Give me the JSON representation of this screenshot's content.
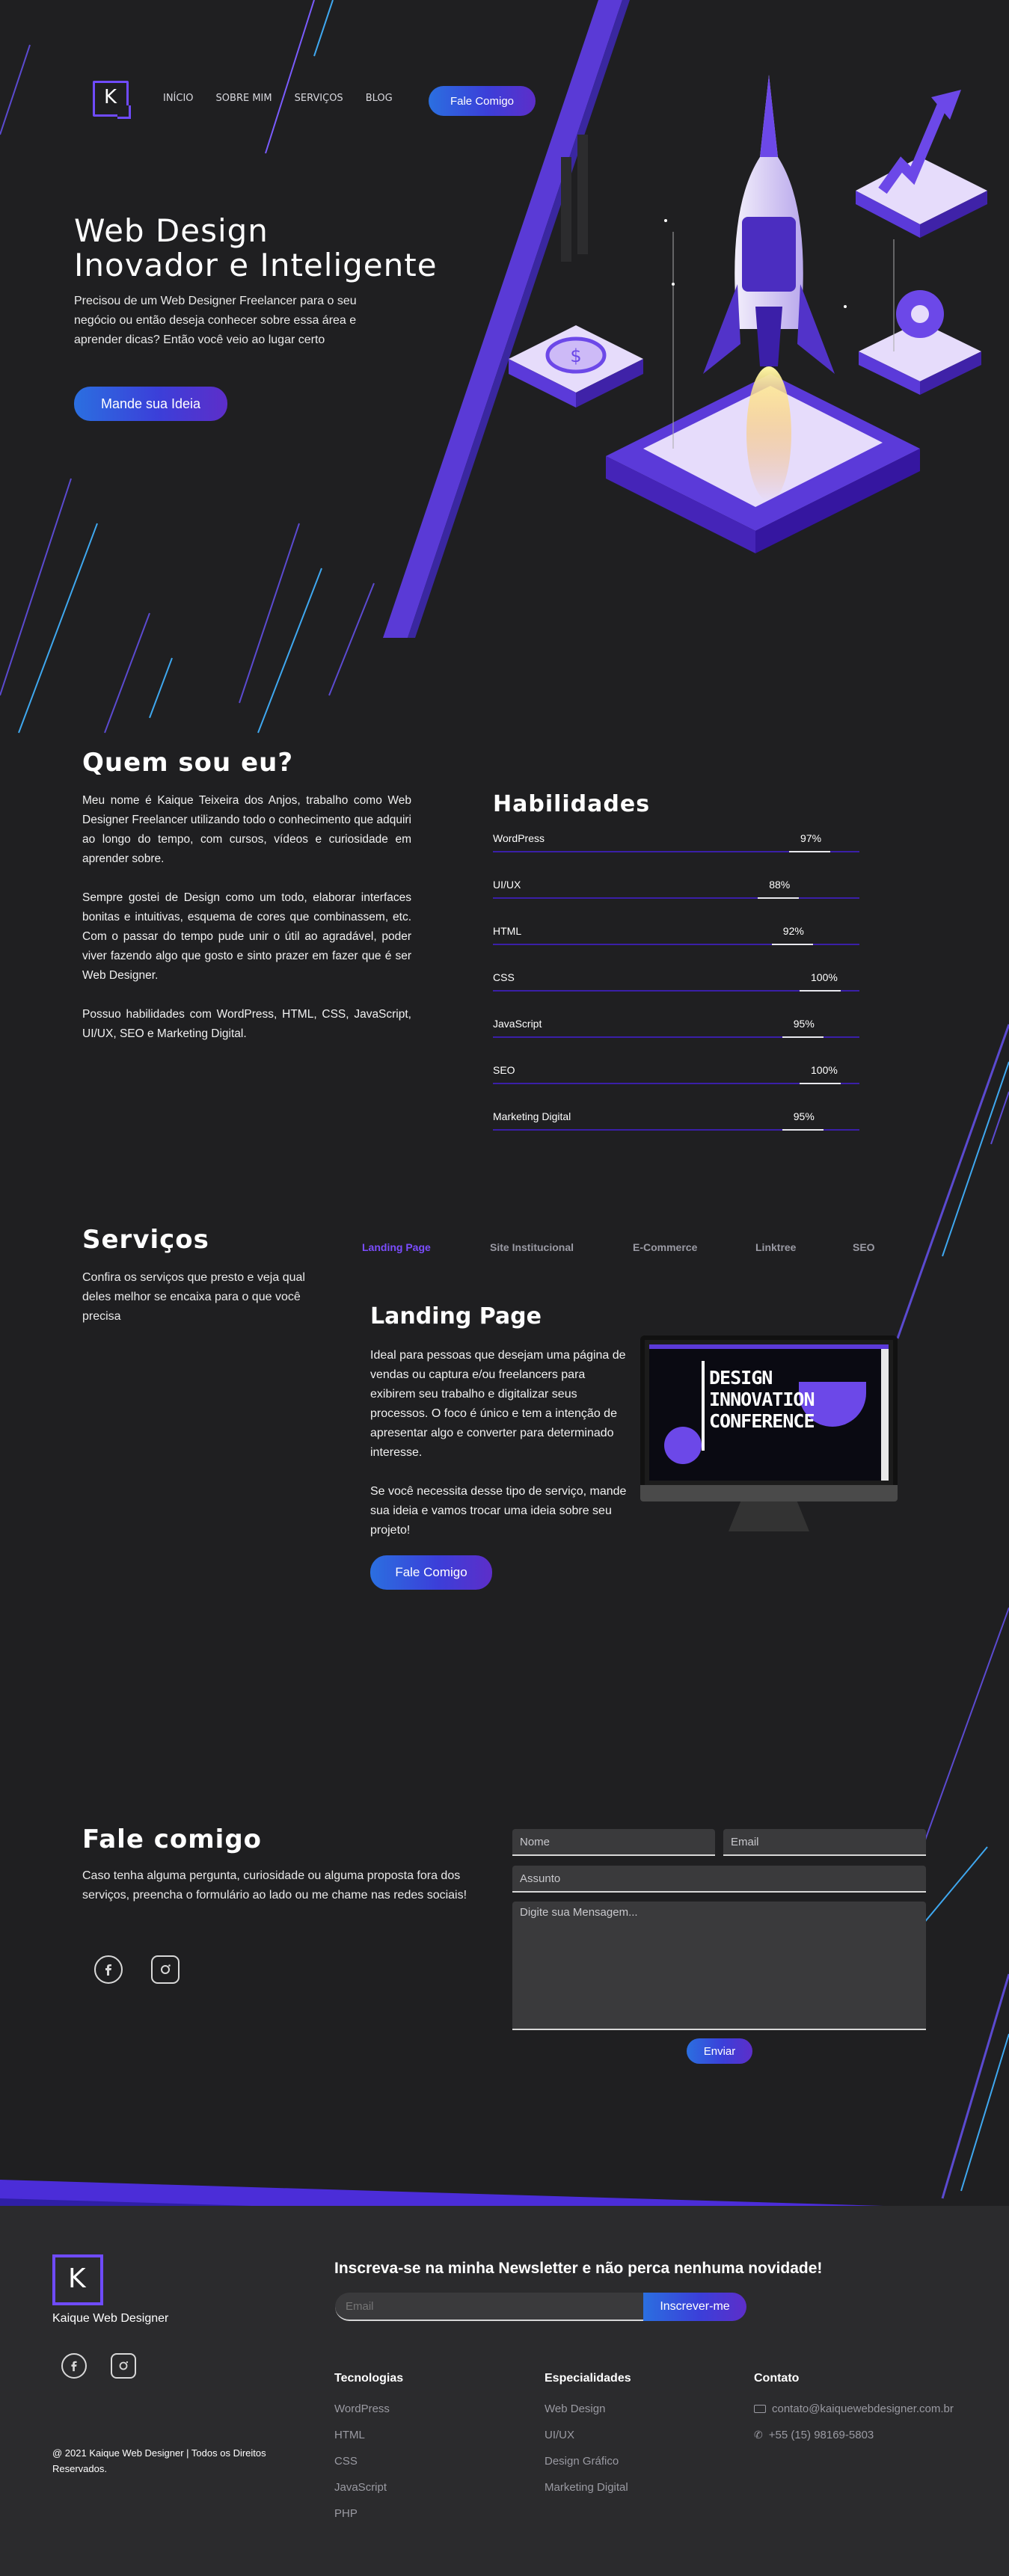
{
  "nav": {
    "logo_letter": "K",
    "items": [
      "INÍCIO",
      "SOBRE MIM",
      "SERVIÇOS",
      "BLOG"
    ],
    "cta": "Fale Comigo"
  },
  "hero": {
    "title_line1": "Web Design",
    "title_line2": "Inovador e Inteligente",
    "text": "Precisou de um Web Designer Freelancer para o seu negócio ou então deseja conhecer sobre essa área e aprender dicas? Então você veio ao lugar certo",
    "cta": "Mande sua Ideia"
  },
  "about": {
    "title": "Quem sou eu?",
    "p1": "Meu nome é Kaique Teixeira dos Anjos, trabalho como Web Designer Freelancer utilizando todo o conhecimento que adquiri ao longo do tempo, com cursos, vídeos e curiosidade em aprender sobre.",
    "p2": "Sempre gostei de Design como um todo, elaborar interfaces bonitas e intuitivas, esquema de cores que combinassem, etc. Com o passar do tempo pude unir o útil ao agradável, poder viver fazendo algo que gosto e sinto prazer em fazer que é ser Web Designer.",
    "p3": "Possuo habilidades com WordPress, HTML, CSS, JavaScript, UI/UX, SEO e Marketing Digital."
  },
  "skills": {
    "title": "Habilidades",
    "items": [
      {
        "name": "WordPress",
        "percent": 97,
        "label": "97%"
      },
      {
        "name": "UI/UX",
        "percent": 88,
        "label": "88%"
      },
      {
        "name": "HTML",
        "percent": 92,
        "label": "92%"
      },
      {
        "name": "CSS",
        "percent": 100,
        "label": "100%"
      },
      {
        "name": "JavaScript",
        "percent": 95,
        "label": "95%"
      },
      {
        "name": "SEO",
        "percent": 100,
        "label": "100%"
      },
      {
        "name": "Marketing Digital",
        "percent": 95,
        "label": "95%"
      }
    ]
  },
  "services": {
    "title": "Serviços",
    "intro": "Confira os serviços que presto e veja qual deles melhor se encaixa para o que você precisa",
    "tabs": [
      "Landing Page",
      "Site Institucional",
      "E-Commerce",
      "Linktree",
      "SEO"
    ],
    "active_tab": "Landing Page",
    "active_color": "#7b4dff",
    "detail_title": "Landing Page",
    "detail_p1": "Ideal para pessoas que desejam uma página de vendas ou captura e/ou freelancers para exibirem seu trabalho e digitalizar seus processos. O foco é único e tem a intenção de apresentar algo e converter para determinado interesse.",
    "detail_p2": "Se você necessita desse tipo de serviço, mande sua ideia e vamos trocar uma ideia sobre seu projeto!",
    "cta": "Fale Comigo",
    "screen_line1": "DESIGN",
    "screen_line2": "INNOVATION",
    "screen_line3": "CONFERENCE"
  },
  "contact": {
    "title": "Fale comigo",
    "text": "Caso tenha alguma pergunta, curiosidade ou alguma proposta fora dos serviços, preencha o formulário ao lado ou me chame nas redes sociais!",
    "name_placeholder": "Nome",
    "email_placeholder": "Email",
    "subject_placeholder": "Assunto",
    "message_placeholder": "Digite sua Mensagem...",
    "submit": "Enviar",
    "social_icons": [
      "facebook-icon",
      "instagram-icon"
    ]
  },
  "footer": {
    "brand": "Kaique Web Designer",
    "newsletter_title": "Inscreva-se na minha Newsletter e não perca nenhuma novidade!",
    "newsletter_placeholder": "Email",
    "newsletter_button": "Inscrever-me",
    "copyright": "@ 2021 Kaique Web Designer | Todos os Direitos Reservados.",
    "tech_title": "Tecnologias",
    "tech": [
      "WordPress",
      "HTML",
      "CSS",
      "JavaScript",
      "PHP"
    ],
    "spec_title": "Especialidades",
    "spec": [
      "Web Design",
      "UI/UX",
      "Design Gráfico",
      "Marketing Digital"
    ],
    "contact_title": "Contato",
    "email": "contato@kaiquewebdesigner.com.br",
    "phone": "+55 (15) 98169-5803"
  },
  "colors": {
    "background": "#1f1f21",
    "accent_purple": "#6f4bff",
    "accent_blue": "#2b6fe0",
    "footer_bg": "#2b2b2d"
  }
}
